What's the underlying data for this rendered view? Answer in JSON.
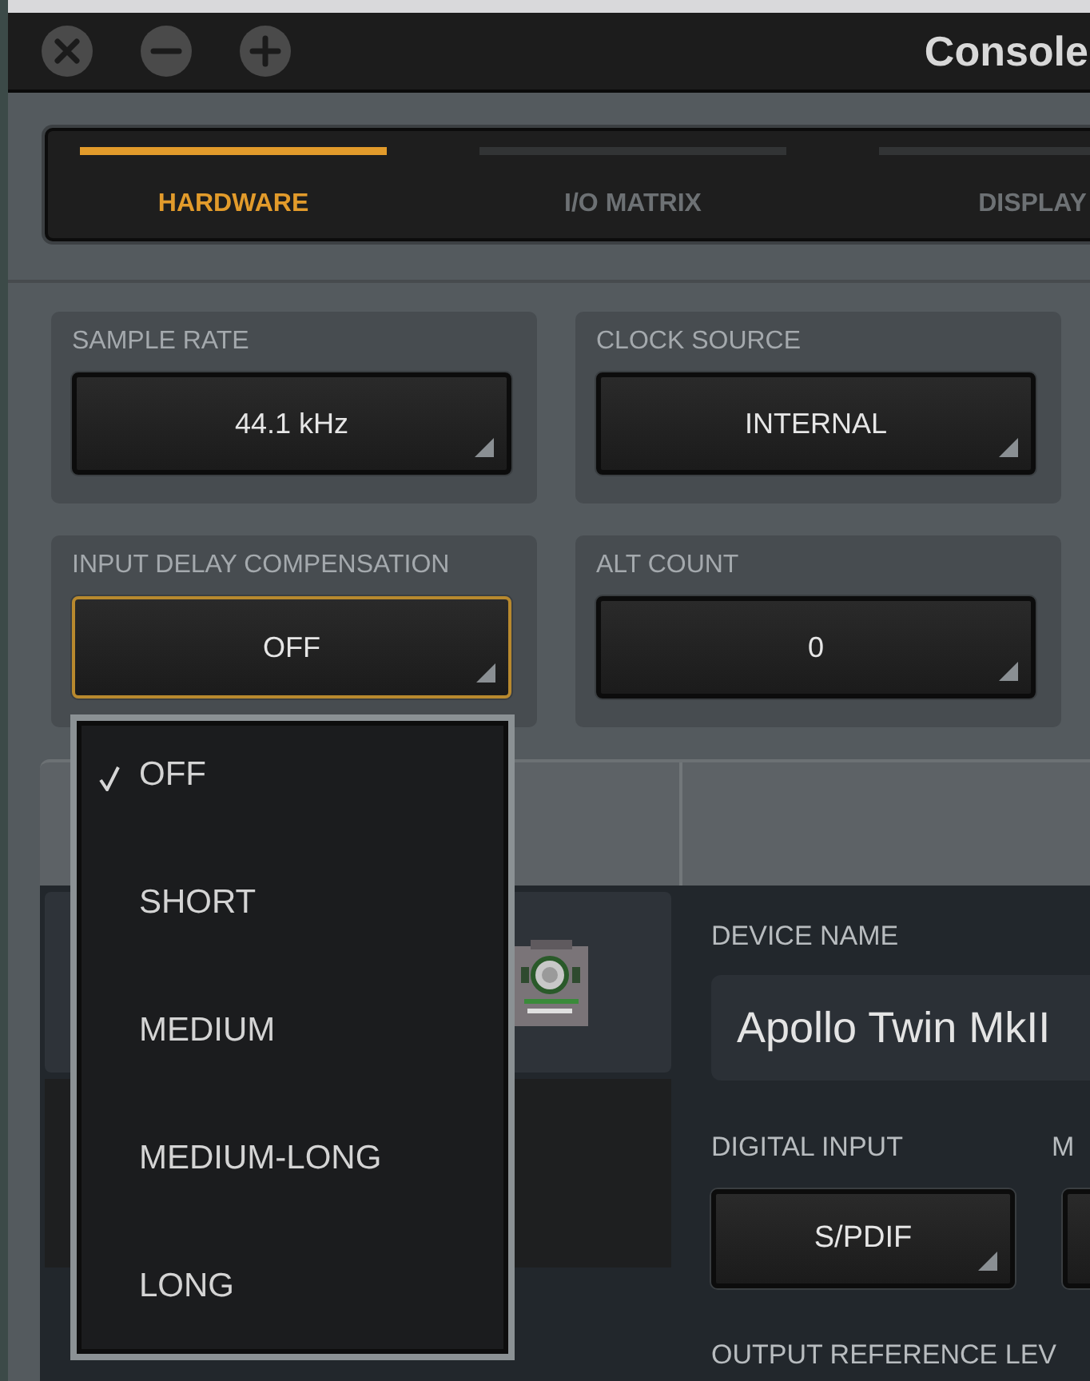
{
  "window": {
    "title": "Console"
  },
  "window_buttons": [
    {
      "kind": "close"
    },
    {
      "kind": "minimize"
    },
    {
      "kind": "zoom"
    }
  ],
  "tabs": [
    {
      "label": "HARDWARE",
      "selected": true
    },
    {
      "label": "I/O MATRIX",
      "selected": false
    },
    {
      "label": "DISPLAY",
      "selected": false
    }
  ],
  "settings": [
    {
      "label": "SAMPLE RATE",
      "value": "44.1 kHz",
      "open": false
    },
    {
      "label": "CLOCK SOURCE",
      "value": "INTERNAL",
      "open": false
    },
    {
      "label": "INPUT DELAY COMPENSATION",
      "value": "OFF",
      "open": true
    },
    {
      "label": "ALT COUNT",
      "value": "0",
      "open": false
    }
  ],
  "dropdown_menu": {
    "items": [
      {
        "label": "OFF",
        "checked": true
      },
      {
        "label": "SHORT",
        "checked": false
      },
      {
        "label": "MEDIUM",
        "checked": false
      },
      {
        "label": "MEDIUM-LONG",
        "checked": false
      },
      {
        "label": "LONG",
        "checked": false
      }
    ]
  },
  "device": {
    "name_label": "DEVICE NAME",
    "name": "Apollo Twin MkII",
    "digital_input_label": "DIGITAL INPUT",
    "digital_input": "S/PDIF",
    "column_2_label": "M",
    "output_reference_label": "OUTPUT REFERENCE LEV"
  }
}
